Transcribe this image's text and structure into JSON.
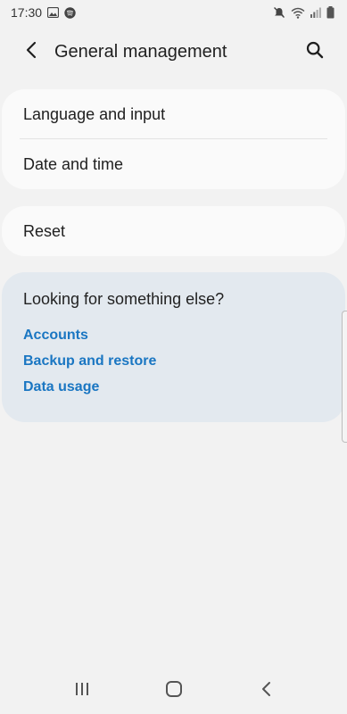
{
  "status_bar": {
    "time": "17:30",
    "left_icons": [
      "gallery-icon",
      "spotify-icon"
    ],
    "right_icons": [
      "mute-icon",
      "wifi-icon",
      "signal-icon",
      "battery-icon"
    ]
  },
  "header": {
    "title": "General management",
    "back_icon": "back-chevron-icon",
    "search_icon": "search-icon"
  },
  "settings": {
    "group1": [
      "Language and input",
      "Date and time"
    ],
    "group2": [
      "Reset"
    ]
  },
  "suggestions": {
    "title": "Looking for something else?",
    "links": [
      "Accounts",
      "Backup and restore",
      "Data usage"
    ]
  },
  "nav_bar": {
    "icons": [
      "recents-icon",
      "home-icon",
      "back-icon"
    ]
  },
  "colors": {
    "background": "#f2f2f2",
    "card": "#fafafa",
    "suggestion_card": "#e3e9ef",
    "link": "#1a76c2"
  }
}
